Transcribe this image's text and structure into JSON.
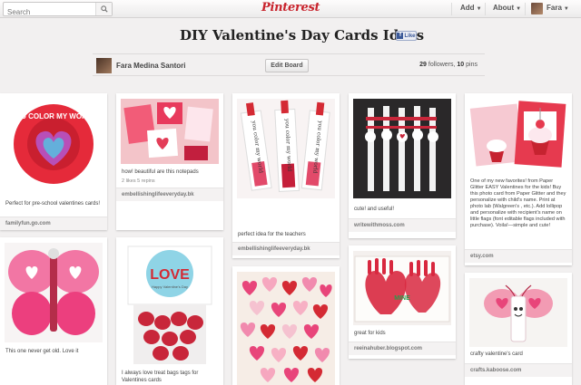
{
  "nav": {
    "search_placeholder": "Search",
    "logo": "Pinterest",
    "add_label": "Add",
    "about_label": "About",
    "user_label": "Fara"
  },
  "board": {
    "title": "DIY Valentine's Day Cards Ideas",
    "like_label": "Like",
    "owner": "Fara Medina Santori",
    "edit_label": "Edit Board",
    "followers_count": "29",
    "followers_label": "followers,",
    "pins_count": "10",
    "pins_label": "pins"
  },
  "pins": [
    {
      "desc": "Perfect for pre-school valentines cards!",
      "source": "familyfun.go.com"
    },
    {
      "desc": "how! beautiful are this notepads",
      "stats": "2 likes  5 repins",
      "source": "embellishinglifeeveryday.bk"
    },
    {
      "desc": "perfect idea for the teachers",
      "source": "embellishinglifeeveryday.bk"
    },
    {
      "desc": "cute! and useful!",
      "source": "writewithmoss.com"
    },
    {
      "desc": "One of my new favorites! from Paper Glitter EASY Valentines for the kids! Buy this photo card from Paper Glitter and they personalize with child's name. Print at photo lab (Walgreen's , etc.). Add lollipop and personalize with recipient's name on little flags (font editable flags included with purchase). Voila!—simple and cute!",
      "source": "etsy.com"
    },
    {
      "desc": "This one never get old. Love it",
      "source": ""
    },
    {
      "desc": "I always love treat bags tags for Valentines cards",
      "source": ""
    },
    {
      "desc": "",
      "source": ""
    },
    {
      "desc": "great for kids",
      "source": "reeinahuber.blogspot.com"
    },
    {
      "desc": "crafty valentine's card",
      "source": "crafts.kaboose.com"
    }
  ],
  "images": {
    "pin1_text": "YOU COLOR MY WORLD",
    "pin3_tags": [
      "you color my world",
      "you color my world",
      "you color my world"
    ],
    "pin7_love": "LOVE",
    "pin7_happy": "Happy Valentine's Day",
    "pin8_mini": "MINE"
  },
  "colors": {
    "brand": "#c8232c",
    "pink": "#e8457a",
    "red": "#d42a34"
  }
}
